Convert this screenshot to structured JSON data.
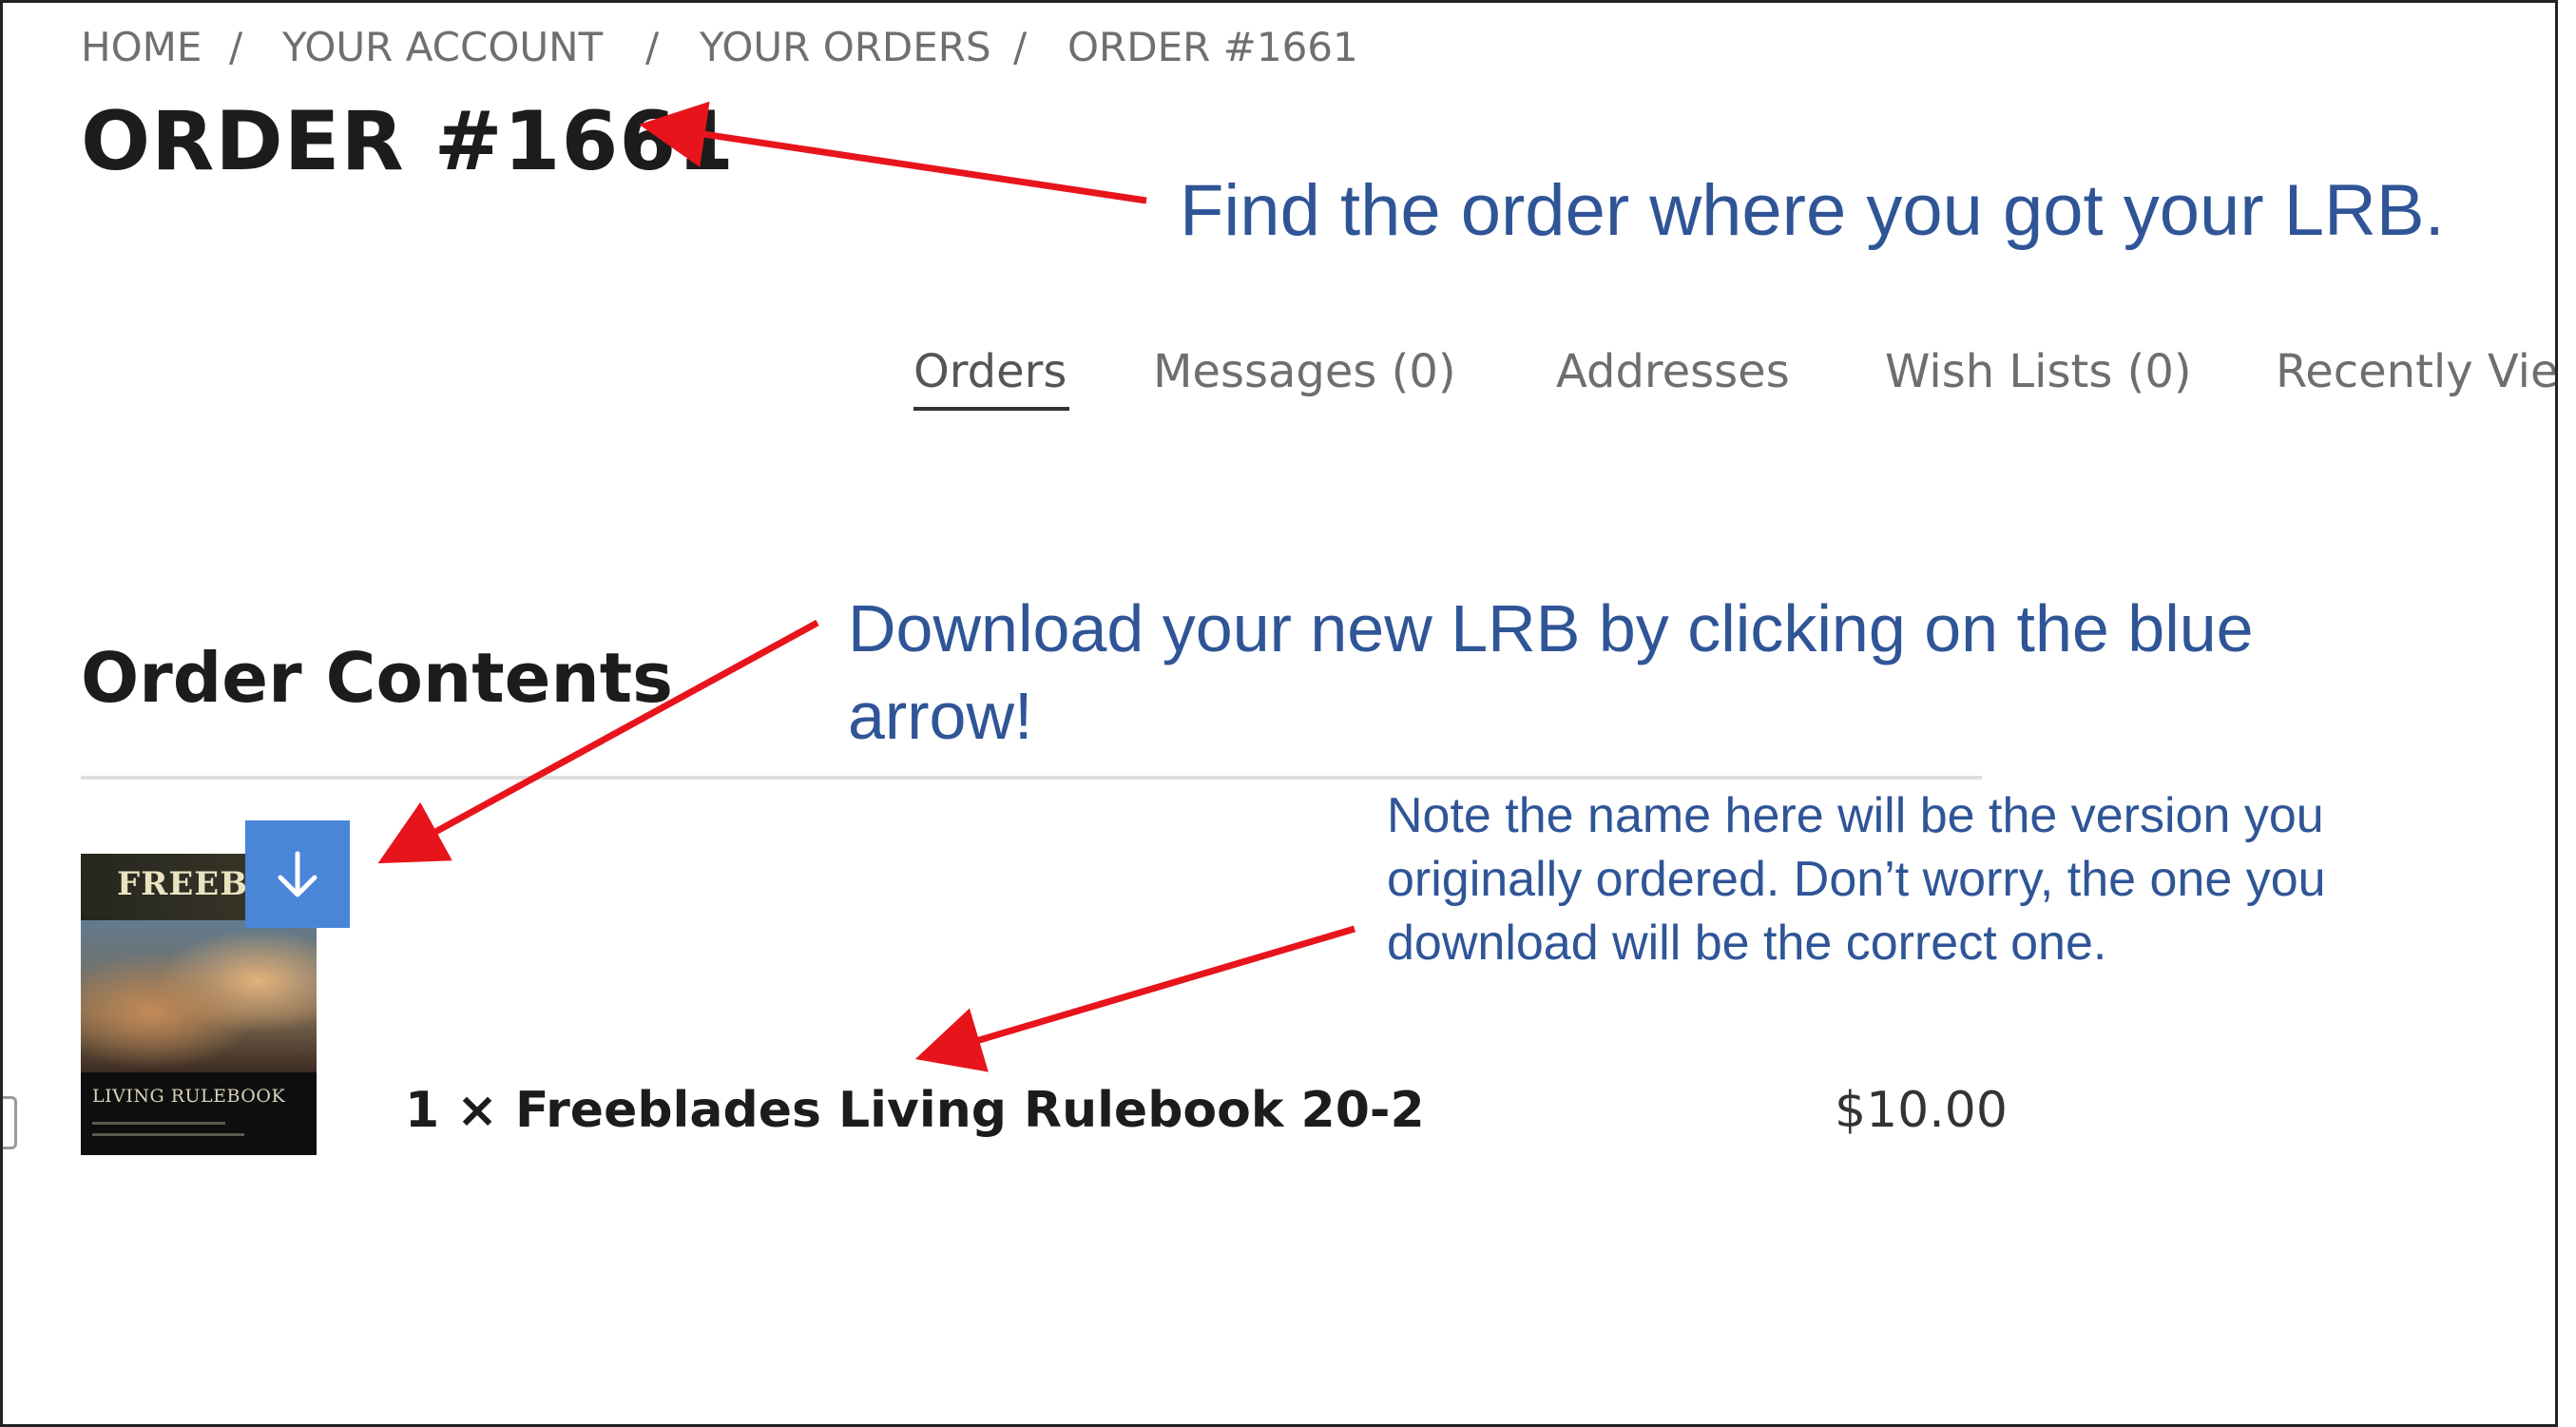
{
  "breadcrumb": {
    "items": [
      "HOME",
      "YOUR ACCOUNT",
      "YOUR ORDERS",
      "ORDER #1661"
    ],
    "separator": "/"
  },
  "page_title": "ORDER #1661",
  "tabs": [
    {
      "label": "Orders",
      "active": true
    },
    {
      "label": "Messages (0)",
      "active": false
    },
    {
      "label": "Addresses",
      "active": false
    },
    {
      "label": "Wish Lists (0)",
      "active": false
    },
    {
      "label": "Recently Vie",
      "active": false
    }
  ],
  "section_title": "Order Contents",
  "order_item": {
    "product_name": "1 × Freeblades Living Rulebook 20-2",
    "price": "$10.00",
    "thumbnail": {
      "cover_title": "FREEBL",
      "cover_caption": "LIVING RULEBOOK"
    },
    "download_icon": "arrow-down-icon"
  },
  "annotations": {
    "find_order": "Find the order where you got your LRB.",
    "download_line1": "Download your new LRB by clicking on the blue",
    "download_line2": "arrow!",
    "note": "Note the name here will be the version you originally ordered.  Don’t worry, the one you download will be the correct one."
  },
  "colors": {
    "annotation_text": "#2f5597",
    "arrow": "#e8141c",
    "download_button": "#4a86d8"
  }
}
